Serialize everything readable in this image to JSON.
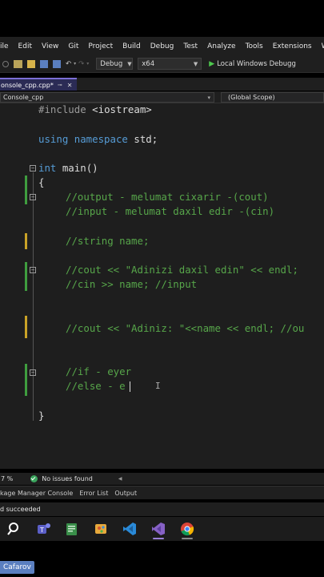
{
  "menu": {
    "items": [
      "ile",
      "Edit",
      "View",
      "Git",
      "Project",
      "Build",
      "Debug",
      "Test",
      "Analyze",
      "Tools",
      "Extensions",
      "Win"
    ]
  },
  "toolbar": {
    "config": "Debug",
    "platform": "x64",
    "run_label": "Local Windows Debugg"
  },
  "tab": {
    "title": "onsole_cpp.cpp*"
  },
  "navbar": {
    "project": "Console_cpp",
    "scope": "(Global Scope)"
  },
  "code": {
    "include_directive": "#include",
    "include_header": "<iostream>",
    "using_kw": "using namespace",
    "using_rest": " std;",
    "main_kw": "int",
    "main_rest": " main()",
    "open_brace": "{",
    "comment_output": "//output - melumat cixarir -(cout)",
    "comment_input": "//input - melumat daxil edir -(cin)",
    "comment_string": "//string name;",
    "comment_cout1": "//cout << \"Adinizi daxil edin\" << endl;",
    "comment_cin": "//cin >> name; //input",
    "comment_cout2": "//cout << \"Adiniz: \"<<name << endl; //ou",
    "comment_if": "//if - eyer",
    "comment_else": "//else - e",
    "close_brace": "}"
  },
  "status": {
    "zoom": "7 %",
    "issues": "No issues found"
  },
  "panel_tabs": [
    "kage Manager Console",
    "Error List",
    "Output"
  ],
  "build_status": "d succeeded",
  "user": {
    "name": "Cafarov"
  },
  "colors": {
    "keyword": "#569cd6",
    "comment": "#57a64a",
    "preprocessor": "#9b9b9b",
    "change_bar_green": "#3f9d3f",
    "change_bar_yellow": "#c9a227",
    "accent": "#7c6fd6"
  },
  "taskbar_icons": [
    "search-icon",
    "teams-icon",
    "notepad-icon",
    "paint-icon",
    "vscode-icon",
    "visual-studio-icon",
    "chrome-icon"
  ]
}
